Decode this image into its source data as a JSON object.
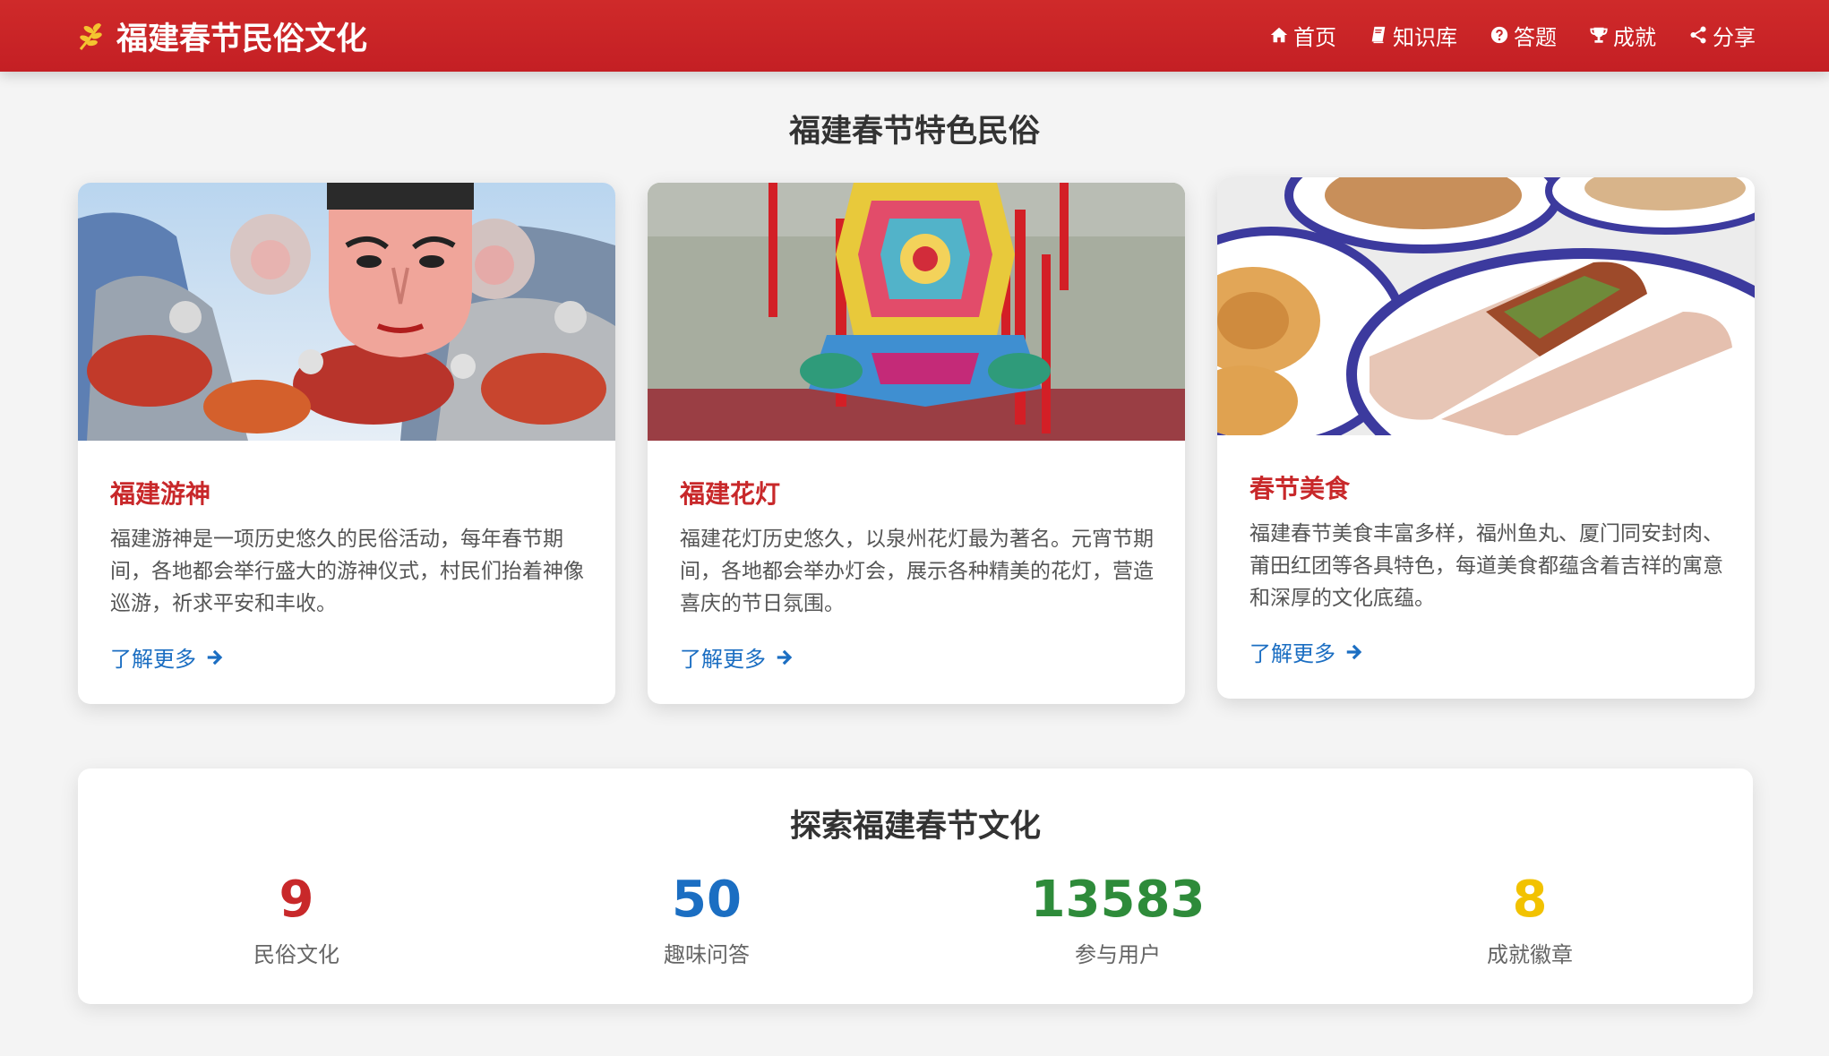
{
  "header": {
    "title": "福建春节民俗文化",
    "logo_icon": "wheat-icon",
    "nav": [
      {
        "label": "首页",
        "icon": "home-icon"
      },
      {
        "label": "知识库",
        "icon": "book-icon"
      },
      {
        "label": "答题",
        "icon": "question-circle-icon"
      },
      {
        "label": "成就",
        "icon": "trophy-icon"
      },
      {
        "label": "分享",
        "icon": "share-icon"
      }
    ]
  },
  "section": {
    "title": "福建春节特色民俗"
  },
  "cards": [
    {
      "title": "福建游神",
      "text": "福建游神是一项历史悠久的民俗活动，每年春节期间，各地都会举行盛大的游神仪式，村民们抬着神像巡游，祈求平安和丰收。",
      "link": "了解更多"
    },
    {
      "title": "福建花灯",
      "text": "福建花灯历史悠久，以泉州花灯最为著名。元宵节期间，各地都会举办灯会，展示各种精美的花灯，营造喜庆的节日氛围。",
      "link": "了解更多"
    },
    {
      "title": "春节美食",
      "text": "福建春节美食丰富多样，福州鱼丸、厦门同安封肉、莆田红团等各具特色，每道美食都蕴含着吉祥的寓意和深厚的文化底蕴。",
      "link": "了解更多"
    }
  ],
  "stats": {
    "title": "探索福建春节文化",
    "items": [
      {
        "value": "9",
        "label": "民俗文化",
        "color": "#c8282a"
      },
      {
        "value": "50",
        "label": "趣味问答",
        "color": "#1b6ec2"
      },
      {
        "value": "13583",
        "label": "参与用户",
        "color": "#2e8b3a"
      },
      {
        "value": "8",
        "label": "成就徽章",
        "color": "#f2c200"
      }
    ]
  },
  "colors": {
    "brand_red": "#c8282a",
    "link_blue": "#1b6ec2"
  }
}
